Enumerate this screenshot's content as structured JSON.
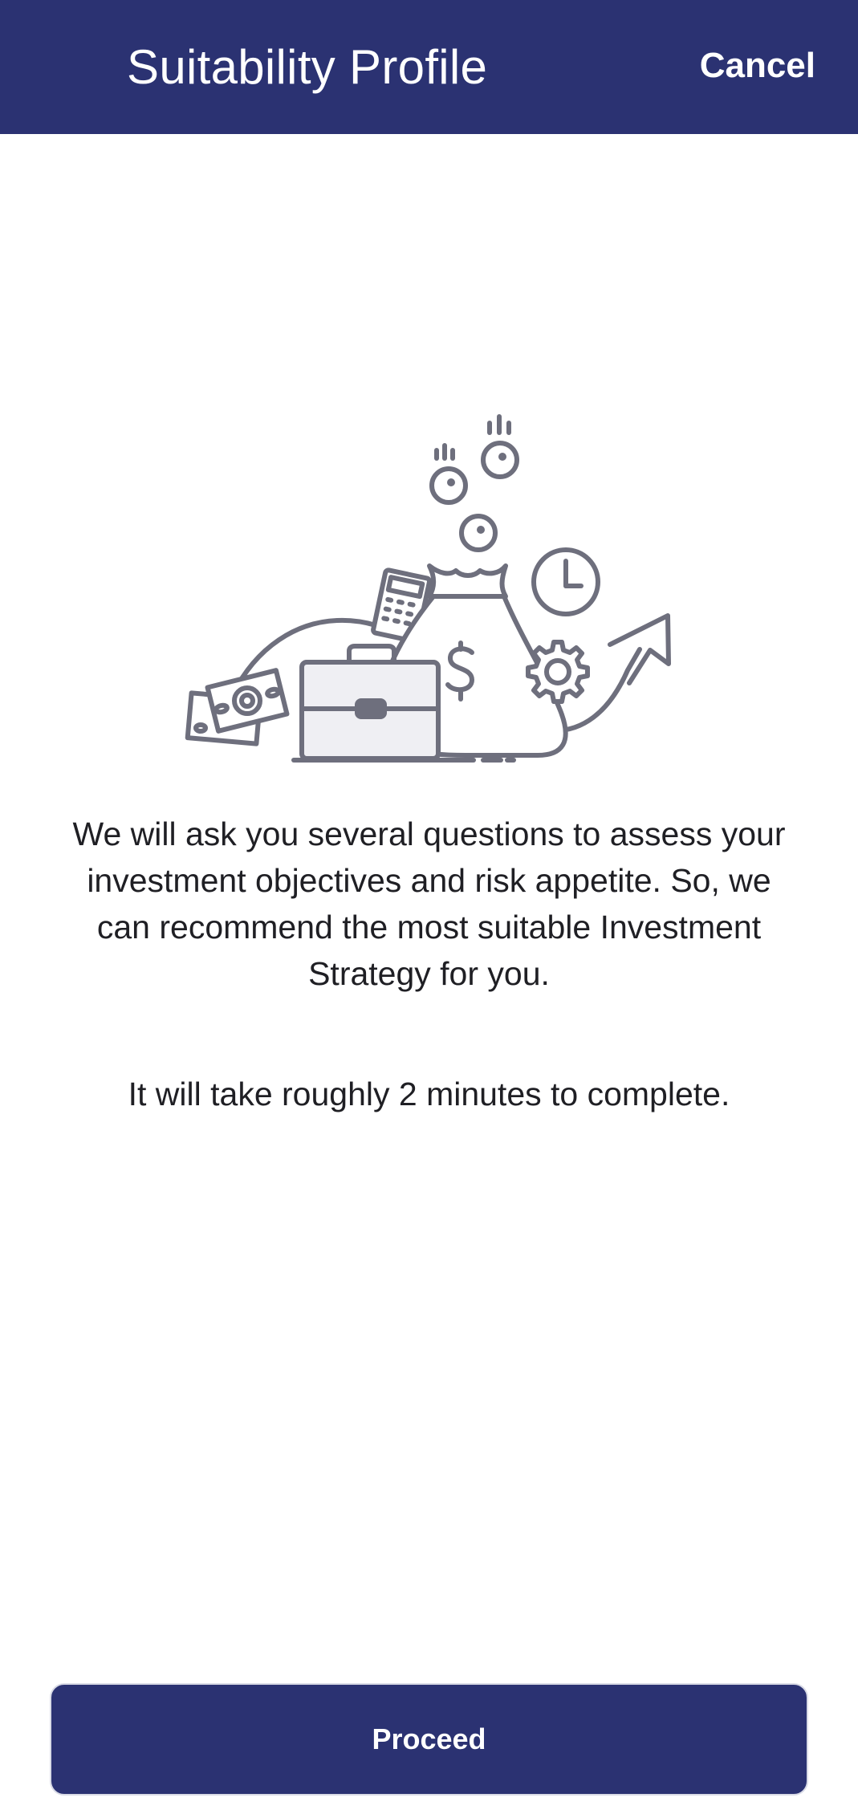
{
  "header": {
    "title": "Suitability Profile",
    "cancel_label": "Cancel",
    "background_color": "#2b3272"
  },
  "illustration": {
    "icon": "money-bag-investment-illustration"
  },
  "body": {
    "intro_text": "We will ask you several questions to assess your investment objectives and risk appetite. So, we can recommend the most suitable Investment Strategy for you.",
    "duration_text": "It will take roughly 2 minutes to complete."
  },
  "footer": {
    "proceed_label": "Proceed",
    "button_color": "#2b3272"
  }
}
